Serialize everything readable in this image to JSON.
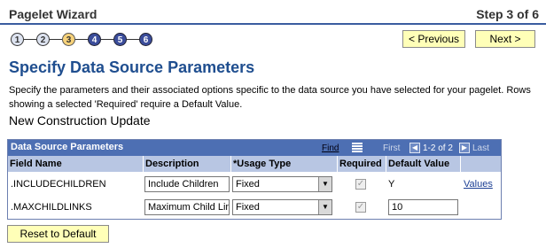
{
  "window": {
    "title": "Pagelet Wizard",
    "step_label": "Step 3 of 6"
  },
  "steps": [
    "1",
    "2",
    "3",
    "4",
    "5",
    "6"
  ],
  "nav": {
    "previous_label": "< Previous",
    "next_label": "Next >"
  },
  "page": {
    "heading": "Specify Data Source Parameters",
    "description": "Specify the parameters and their associated options specific to the data source you have selected for your pagelet.  Rows showing a selected 'Required' require a Default Value.",
    "subtitle": "New Construction Update"
  },
  "grid": {
    "title": "Data Source Parameters",
    "find_label": "Find",
    "first_label": "First",
    "range_label": "1-2 of 2",
    "last_label": "Last",
    "columns": [
      "Field Name",
      "Description",
      "*Usage Type",
      "Required",
      "Default Value"
    ],
    "rows": [
      {
        "field": ".INCLUDECHILDREN",
        "description": "Include Children",
        "usage": "Fixed",
        "default": "Y",
        "link": "Values"
      },
      {
        "field": ".MAXCHILDLINKS",
        "description": "Maximum Child Links",
        "usage": "Fixed",
        "default": "10",
        "link": ""
      }
    ]
  },
  "reset_label": "Reset to Default",
  "colors": {
    "accent": "#1f4e8f",
    "grid_header": "#4d6fb3",
    "button_bg": "#ffffb8"
  }
}
